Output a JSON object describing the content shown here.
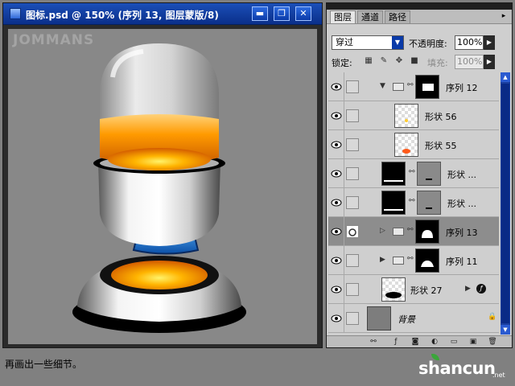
{
  "document": {
    "title": "图标.psd @ 150% (序列 13, 图层蒙版/8)",
    "buttons": {
      "minimize": "▬",
      "restore": "❐",
      "close": "✕"
    },
    "canvas_watermark": "JOMMANS"
  },
  "layers_panel": {
    "tabs": [
      {
        "label": "图层"
      },
      {
        "label": "通道"
      },
      {
        "label": "路径"
      }
    ],
    "menu_arrow": "▸",
    "blend_mode": "穿过",
    "opacity_label": "不透明度:",
    "opacity_value": "100%",
    "lock_label": "锁定:",
    "fill_label": "填充:",
    "fill_value": "100%",
    "layers": [
      {
        "name": "序列 12",
        "kind": "group",
        "expanded": true,
        "visible": true
      },
      {
        "name": "形状 56",
        "kind": "shape",
        "visible": true
      },
      {
        "name": "形状 55",
        "kind": "shape",
        "visible": true
      },
      {
        "name": "形状 ...",
        "kind": "masked-shape",
        "visible": true
      },
      {
        "name": "形状 ...",
        "kind": "masked-shape",
        "visible": true
      },
      {
        "name": "序列 13",
        "kind": "group",
        "expanded": false,
        "visible": true,
        "selected": true
      },
      {
        "name": "序列 11",
        "kind": "group",
        "expanded": false,
        "visible": true
      },
      {
        "name": "形状 27",
        "kind": "shape-fx",
        "visible": true
      },
      {
        "name": "背景",
        "kind": "background",
        "visible": true,
        "locked": true
      }
    ]
  },
  "caption": "再画出一些细节。",
  "site_watermark": {
    "main": "shancun",
    "sub": ".net"
  },
  "colors": {
    "title_bar": "#0a3aa8",
    "accent_orange": "#ff9a00",
    "accent_blue": "#1a7fd8",
    "selected_row": "#8d8d8d"
  }
}
